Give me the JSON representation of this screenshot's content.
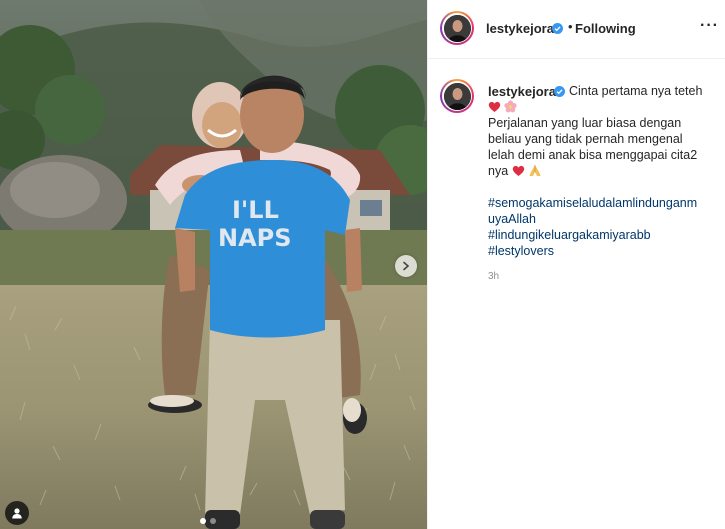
{
  "post": {
    "username": "lestykejora",
    "separator": "•",
    "follow_status": "Following",
    "more_label": "···",
    "caption": {
      "first_line_text": "Cinta pertama nya teteh",
      "body_lines": [
        "Perjalanan yang luar biasa dengan",
        "beliau yang tidak pernah mengenal",
        "lelah demi anak bisa menggapai cita2",
        "nya"
      ],
      "hashtags": [
        "#semogakamiselaludalamlindunganm",
        "uyaAllah",
        "#lindungikeluargakamiyarabb",
        "#lestylovers"
      ]
    },
    "timestamp": "3h"
  },
  "photo": {
    "shirt_text_line1": "I'LL",
    "shirt_text_line2": "NAPS",
    "carousel_dots": 2,
    "active_dot": 0
  },
  "icons": {
    "verified": "verified-badge-icon",
    "heart": "red-heart-emoji",
    "flower": "cherry-blossom-emoji",
    "pray": "folded-hands-emoji",
    "next": "chevron-right-icon",
    "tag": "user-tag-icon"
  },
  "colors": {
    "accent_link": "#00376b",
    "verified_blue": "#3897f0",
    "shirt_blue": "#2f8ed8",
    "muted_text": "#8e8e8e"
  }
}
